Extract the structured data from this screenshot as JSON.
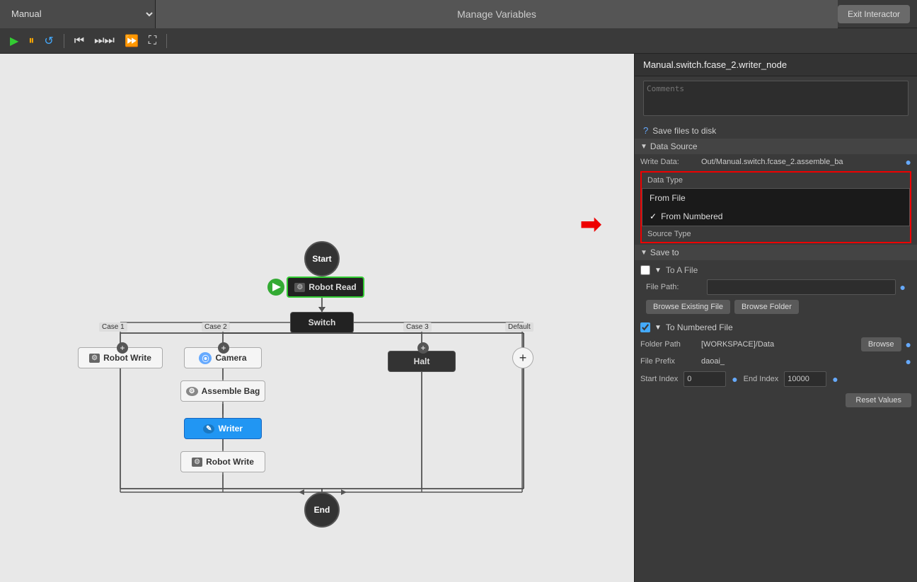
{
  "topbar": {
    "manual_label": "Manual",
    "manage_vars_label": "Manage Variables",
    "exit_interactor_label": "Exit Interactor"
  },
  "toolbar": {
    "play_icon": "▶",
    "pause_icon": "⏸",
    "refresh_icon": "↺",
    "step_icon": "⏭",
    "skip_icon": "⏭⏭",
    "fwd_icon": "⏩",
    "cam_icon": "📷"
  },
  "panel": {
    "title": "Manual.switch.fcase_2.writer_node",
    "comments_placeholder": "Comments",
    "save_files_label": "Save files to disk",
    "data_source_label": "Data Source",
    "write_data_label": "Write Data:",
    "write_data_value": "Out/Manual.switch.fcase_2.assemble_ba",
    "data_type_label": "Data Type",
    "source_type_label": "Source Type",
    "dropdown_from_file": "From File",
    "dropdown_from_numbered": "From Numbered",
    "save_to_label": "Save to",
    "to_a_file_label": "To A File",
    "file_path_label": "File Path:",
    "browse_existing_label": "Browse Existing File",
    "browse_folder_label": "Browse Folder",
    "to_numbered_label": "To Numbered File",
    "folder_path_label": "Folder Path",
    "folder_path_value": "[WORKSPACE]/Data",
    "browse_label": "Browse",
    "file_prefix_label": "File Prefix",
    "file_prefix_value": "daoai_",
    "start_index_label": "Start Index",
    "start_index_value": "0",
    "end_index_label": "End Index",
    "end_index_value": "10000",
    "reset_values_label": "Reset Values"
  },
  "flow": {
    "start_label": "Start",
    "end_label": "End",
    "robot_read_label": "Robot Read",
    "switch_label": "Switch",
    "case1_label": "Case 1",
    "case2_label": "Case 2",
    "case3_label": "Case 3",
    "default_label": "Default",
    "robot_write_label": "Robot Write",
    "camera_label": "Camera",
    "assemble_bag_label": "Assemble Bag",
    "writer_label": "Writer",
    "robot_write2_label": "Robot Write",
    "halt_label": "Halt"
  }
}
